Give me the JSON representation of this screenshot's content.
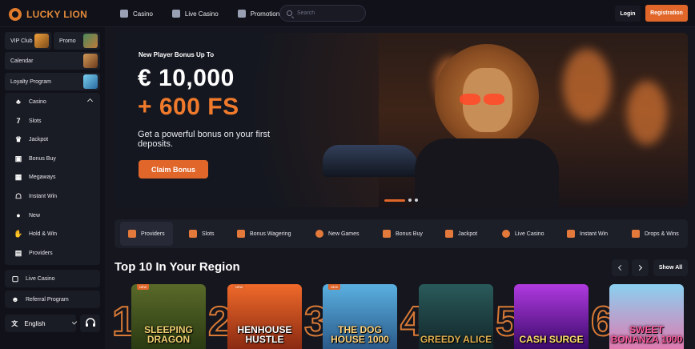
{
  "brand": {
    "name": "LUCKY LION"
  },
  "topnav": [
    {
      "label": "Casino",
      "icon": "casino-chip-icon"
    },
    {
      "label": "Live Casino",
      "icon": "live-dealer-icon"
    },
    {
      "label": "Promotions",
      "icon": "gift-icon"
    }
  ],
  "search": {
    "placeholder": "Search"
  },
  "auth": {
    "login": "Login",
    "register": "Registration"
  },
  "sidebar": {
    "promos": [
      {
        "label": "VIP Club",
        "icon": "crown-icon"
      },
      {
        "label": "Promo",
        "icon": "promo-card-icon"
      }
    ],
    "calendar": "Calendar",
    "loyalty": "Loyalty Program",
    "casino": {
      "label": "Casino",
      "items": [
        {
          "label": "Slots",
          "icon": "seven-icon"
        },
        {
          "label": "Jackpot",
          "icon": "crown-icon"
        },
        {
          "label": "Bonus Buy",
          "icon": "gift-box-icon"
        },
        {
          "label": "Megaways",
          "icon": "megaways-icon"
        },
        {
          "label": "Instant Win",
          "icon": "rocket-icon"
        },
        {
          "label": "New",
          "icon": "new-badge-icon"
        },
        {
          "label": "Hold & Win",
          "icon": "coin-hand-icon"
        },
        {
          "label": "Providers",
          "icon": "providers-icon"
        }
      ]
    },
    "live_casino": "Live Casino",
    "referral": "Referral Program",
    "language": "English"
  },
  "hero": {
    "kicker": "New Player Bonus Up To",
    "amount": "€ 10,000",
    "free_spins": "+ 600 FS",
    "description": "Get a powerful bonus on your first deposits.",
    "cta": "Claim Bonus",
    "slides": 3,
    "active_slide": 1
  },
  "categories": [
    {
      "label": "Providers",
      "icon": "providers-icon"
    },
    {
      "label": "Slots",
      "icon": "seven-icon"
    },
    {
      "label": "Bonus Wagering",
      "icon": "wagering-icon"
    },
    {
      "label": "New Games",
      "icon": "new-badge-icon"
    },
    {
      "label": "Bonus Buy",
      "icon": "gift-box-icon"
    },
    {
      "label": "Jackpot",
      "icon": "crown-icon"
    },
    {
      "label": "Live Casino",
      "icon": "live-dealer-icon"
    },
    {
      "label": "Instant Win",
      "icon": "rocket-icon"
    },
    {
      "label": "Drops & Wins",
      "icon": "drops-icon"
    }
  ],
  "top10": {
    "title": "Top 10 In Your Region",
    "show_all": "Show All",
    "games": [
      {
        "rank": "1",
        "name": "SLEEPING DRAGON",
        "tag": "NEW",
        "color": "#3b4a1c"
      },
      {
        "rank": "2",
        "name": "HENHOUSE HUSTLE",
        "tag": "NEW",
        "color": "#c8461c"
      },
      {
        "rank": "3",
        "name": "THE DOG HOUSE 1000",
        "tag": "NEW",
        "color": "#2f7fb0"
      },
      {
        "rank": "4",
        "name": "GREEDY ALICE",
        "tag": "",
        "color": "#1f3a3a"
      },
      {
        "rank": "5",
        "name": "CASH SURGE",
        "tag": "",
        "color": "#5a1f8a"
      },
      {
        "rank": "6",
        "name": "SWEET BONANZA 1000",
        "tag": "",
        "color": "#5fb0e0"
      }
    ]
  },
  "colors": {
    "accent": "#e0662a",
    "background": "#15161e",
    "panel": "#1c1e28"
  }
}
